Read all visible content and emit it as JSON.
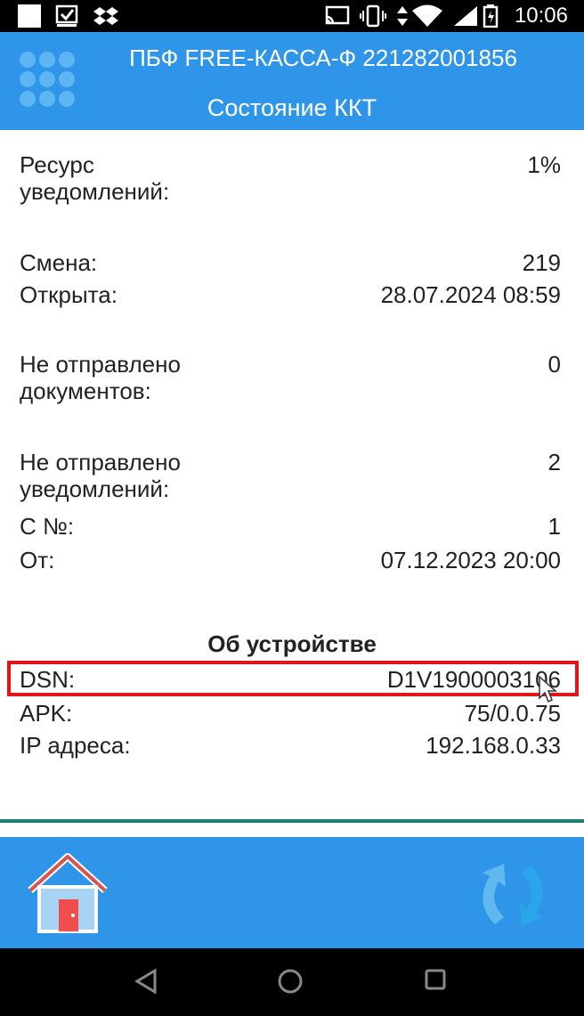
{
  "status_bar": {
    "time": "10:06",
    "icons": [
      "notification-square-icon",
      "check-box-icon",
      "dropbox-icon",
      "cast-icon",
      "vibrate-icon",
      "data-arrows-icon",
      "wifi-icon",
      "battery-icon"
    ]
  },
  "header": {
    "title": "ПБФ FREE-КАССА-Ф 221282001856",
    "subtitle": "Состояние ККТ"
  },
  "rows": [
    {
      "label_1": "Ресурс",
      "label_2": "уведомлений:",
      "value": "1%"
    },
    {
      "label": "Смена:",
      "value": "219"
    },
    {
      "label": "Открыта:",
      "value": "28.07.2024 08:59"
    },
    {
      "label_1": "Не отправлено",
      "label_2": "документов:",
      "value": "0"
    },
    {
      "label_1": "Не отправлено",
      "label_2": "уведомлений:",
      "value": "2"
    },
    {
      "label": "С №:",
      "value": "1"
    },
    {
      "label": "От:",
      "value": "07.12.2023 20:00"
    }
  ],
  "device_section": {
    "title": "Об устройстве",
    "dsn_label": "DSN:",
    "dsn_value": "D1V1900003106",
    "apk_label": "APK:",
    "apk_value": "75/0.0.75",
    "ip_label": "IP адреса:",
    "ip_value": "192.168.0.33"
  },
  "bottom_bar": {
    "home_icon": "home-icon",
    "sync_icon": "sync-icon"
  },
  "colors": {
    "header_bg": "#2f95e8",
    "highlight": "#e4141b",
    "divider": "#1d7f6e"
  }
}
